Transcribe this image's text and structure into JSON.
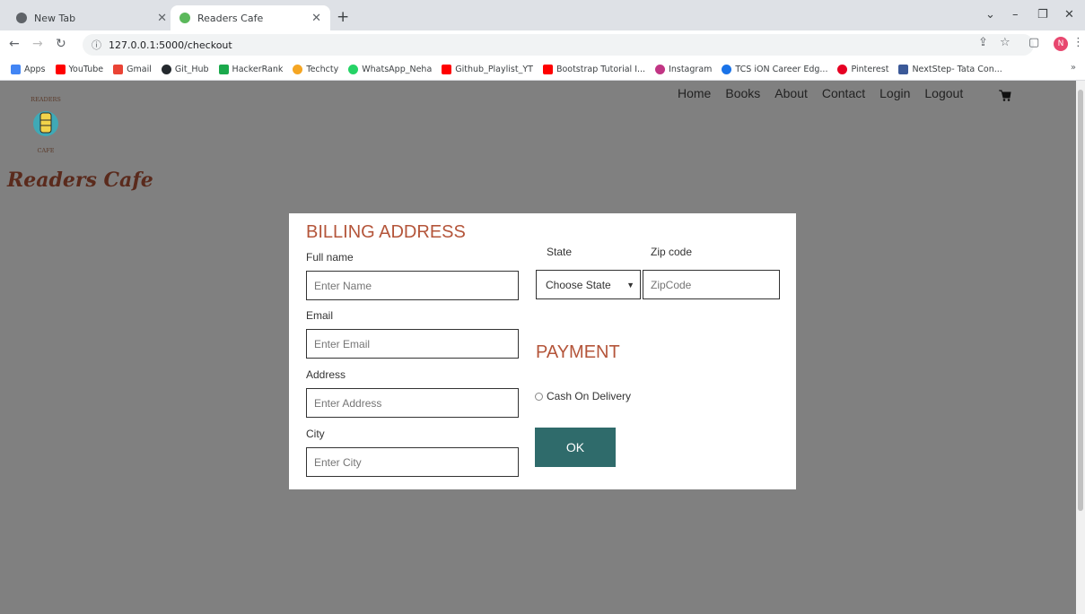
{
  "browser": {
    "tabs": [
      {
        "label": "New Tab",
        "active": false
      },
      {
        "label": "Readers Cafe",
        "active": true
      }
    ],
    "url": "127.0.0.1:5000/checkout",
    "avatar_letter": "N",
    "bookmarks": [
      {
        "label": "Apps",
        "color": "#4285f4"
      },
      {
        "label": "YouTube",
        "color": "#ff0000"
      },
      {
        "label": "Gmail",
        "color": "#ea4335"
      },
      {
        "label": "Git_Hub",
        "color": "#24292e"
      },
      {
        "label": "HackerRank",
        "color": "#1ba94c"
      },
      {
        "label": "Techcty",
        "color": "#f5a623"
      },
      {
        "label": "WhatsApp_Neha",
        "color": "#25d366"
      },
      {
        "label": "Github_Playlist_YT",
        "color": "#ff0000"
      },
      {
        "label": "Bootstrap Tutorial I...",
        "color": "#ff0000"
      },
      {
        "label": "Instagram",
        "color": "#c13584"
      },
      {
        "label": "TCS iON Career Edg...",
        "color": "#1a73e8"
      },
      {
        "label": "Pinterest",
        "color": "#e60023"
      },
      {
        "label": "NextStep- Tata Con...",
        "color": "#3b5998"
      }
    ]
  },
  "site": {
    "brand": "Readers Cafe",
    "logo_text": {
      "top": "READERS",
      "bottom": "CAFE"
    },
    "nav": [
      "Home",
      "Books",
      "About",
      "Contact",
      "Login",
      "Logout"
    ]
  },
  "checkout": {
    "billing_title": "BILLING ADDRESS",
    "payment_title": "PAYMENT",
    "fullname": {
      "label": "Full name",
      "placeholder": "Enter Name"
    },
    "email": {
      "label": "Email",
      "placeholder": "Enter Email"
    },
    "address": {
      "label": "Address",
      "placeholder": "Enter Address"
    },
    "city": {
      "label": "City",
      "placeholder": "Enter City"
    },
    "state": {
      "label": "State",
      "selected": "Choose State"
    },
    "zip": {
      "label": "Zip code",
      "placeholder": "ZipCode"
    },
    "payment_option": "Cash On Delivery",
    "ok_label": "OK"
  },
  "colors": {
    "accent": "#b4553a",
    "button": "#2f6b6b",
    "page_overlay": "#808080"
  }
}
